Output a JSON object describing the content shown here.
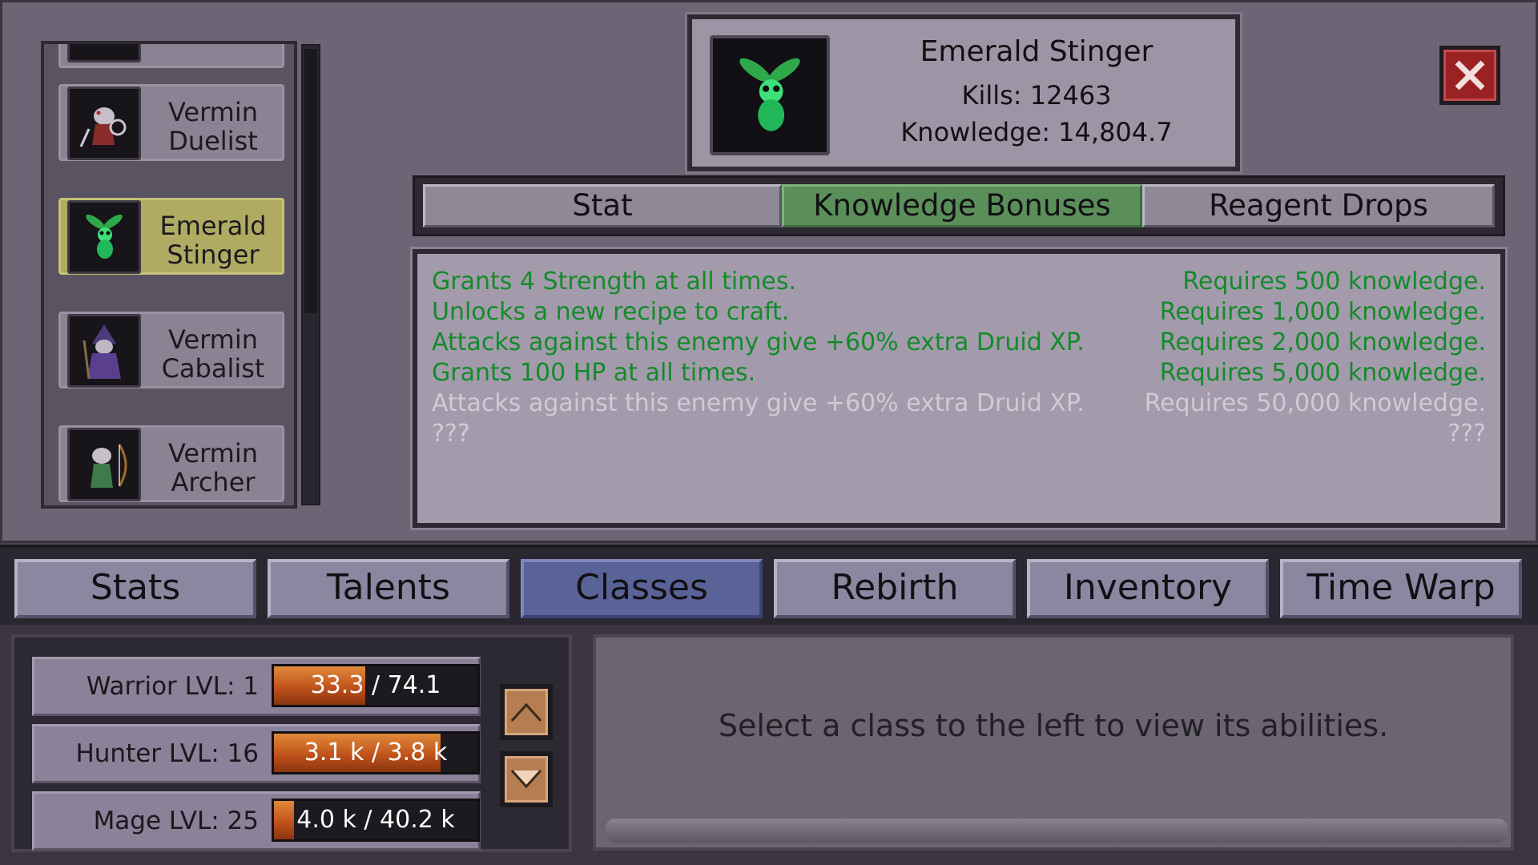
{
  "enemy_list": {
    "items": [
      {
        "name": "Vermin Duelist",
        "icon": "rat-duelist-icon",
        "selected": false
      },
      {
        "name": "Emerald Stinger",
        "icon": "emerald-stinger-icon",
        "selected": true
      },
      {
        "name": "Vermin Cabalist",
        "icon": "rat-cabalist-icon",
        "selected": false
      },
      {
        "name": "Vermin Archer",
        "icon": "rat-archer-icon",
        "selected": false
      }
    ]
  },
  "header": {
    "name": "Emerald Stinger",
    "kills": "Kills: 12463",
    "knowledge": "Knowledge: 14,804.7"
  },
  "info_tabs": [
    {
      "label": "Stat",
      "active": false
    },
    {
      "label": "Knowledge Bonuses",
      "active": true
    },
    {
      "label": "Reagent Drops",
      "active": false
    }
  ],
  "bonuses": [
    {
      "desc": "Grants 4 Strength at all times.",
      "req": "Requires 500 knowledge.",
      "unlocked": true
    },
    {
      "desc": "Unlocks a new recipe to craft.",
      "req": "Requires 1,000 knowledge.",
      "unlocked": true
    },
    {
      "desc": "Attacks against this enemy give +60% extra Druid XP.",
      "req": "Requires 2,000 knowledge.",
      "unlocked": true
    },
    {
      "desc": "Grants 100 HP at all times.",
      "req": "Requires 5,000 knowledge.",
      "unlocked": true
    },
    {
      "desc": "Attacks against this enemy give +60% extra Druid XP.",
      "req": "Requires 50,000 knowledge.",
      "unlocked": false
    },
    {
      "desc": "???",
      "req": "???",
      "unlocked": false
    }
  ],
  "nav_tabs": [
    {
      "label": "Stats",
      "active": false
    },
    {
      "label": "Talents",
      "active": false
    },
    {
      "label": "Classes",
      "active": true
    },
    {
      "label": "Rebirth",
      "active": false
    },
    {
      "label": "Inventory",
      "active": false
    },
    {
      "label": "Time Warp",
      "active": false
    }
  ],
  "classes": [
    {
      "label": "Warrior LVL:  1",
      "xp_text": "33.3 / 74.1",
      "progress": 0.45
    },
    {
      "label": "Hunter LVL:  16",
      "xp_text": "3.1 k / 3.8 k",
      "progress": 0.82
    },
    {
      "label": "Mage LVL:   25",
      "xp_text": "4.0 k / 40.2 k",
      "progress": 0.1
    }
  ],
  "abilities": {
    "hint": "Select a class to the left to view its abilities."
  },
  "colors": {
    "selected_item": "#b0ab62",
    "active_info_tab": "#5b8f5a",
    "active_nav_tab": "#5a6398",
    "unlocked_text": "#148a2b",
    "locked_text": "#d0cad6",
    "xp_fill": "#c0531c",
    "close_button": "#9a2222"
  }
}
